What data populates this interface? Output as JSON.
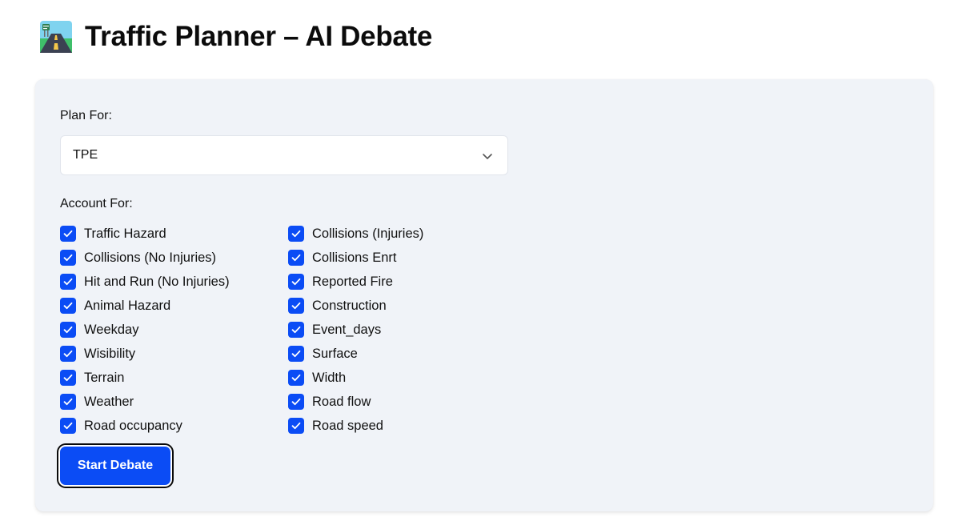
{
  "header": {
    "logo_icon": "highway-road-icon",
    "title": "Traffic Planner – AI Debate"
  },
  "form": {
    "plan_label": "Plan For:",
    "plan_selected": "TPE",
    "account_label": "Account For:",
    "checkboxes": {
      "left": [
        {
          "label": "Traffic Hazard",
          "checked": true
        },
        {
          "label": "Collisions (No Injuries)",
          "checked": true
        },
        {
          "label": "Hit and Run (No Injuries)",
          "checked": true
        },
        {
          "label": "Animal Hazard",
          "checked": true
        },
        {
          "label": "Weekday",
          "checked": true
        },
        {
          "label": "Wisibility",
          "checked": true
        },
        {
          "label": "Terrain",
          "checked": true
        },
        {
          "label": "Weather",
          "checked": true
        },
        {
          "label": "Road occupancy",
          "checked": true
        }
      ],
      "right": [
        {
          "label": "Collisions (Injuries)",
          "checked": true
        },
        {
          "label": "Collisions Enrt",
          "checked": true
        },
        {
          "label": "Reported Fire",
          "checked": true
        },
        {
          "label": "Construction",
          "checked": true
        },
        {
          "label": "Event_days",
          "checked": true
        },
        {
          "label": "Surface",
          "checked": true
        },
        {
          "label": "Width",
          "checked": true
        },
        {
          "label": "Road flow",
          "checked": true
        },
        {
          "label": "Road speed",
          "checked": true
        }
      ]
    },
    "submit_label": "Start Debate"
  },
  "colors": {
    "accent": "#0b4cf5",
    "card_background": "#f0f3f8",
    "page_background": "#ffffff"
  }
}
